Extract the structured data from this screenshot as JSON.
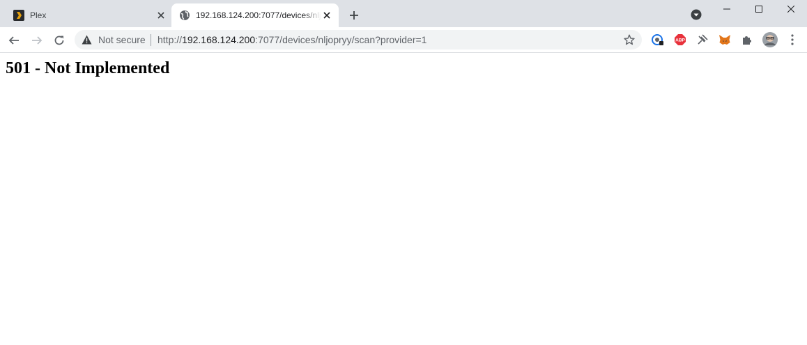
{
  "colors": {
    "tabstrip_bg": "#dee1e6",
    "toolbar_bg": "#ffffff",
    "omnibox_bg": "#f1f3f4",
    "plex_orange": "#e5a00d",
    "abp_red": "#e8313b"
  },
  "tabs": [
    {
      "title": "Plex",
      "favicon": "plex-icon",
      "active": false
    },
    {
      "title": "192.168.124.200:7077/devices/nljopryy/scan?provider=1",
      "favicon": "globe-icon",
      "active": true
    }
  ],
  "omnibox": {
    "security_label": "Not secure",
    "url_scheme": "http://",
    "url_host": "192.168.124.200",
    "url_rest": ":7077/devices/nljopryy/scan?provider=1"
  },
  "extensions": [
    "password-manager-icon",
    "adblock-plus-icon",
    "pin-extension-icon",
    "metamask-fox-icon",
    "puzzle-extensions-icon"
  ],
  "page": {
    "heading": "501 - Not Implemented"
  }
}
